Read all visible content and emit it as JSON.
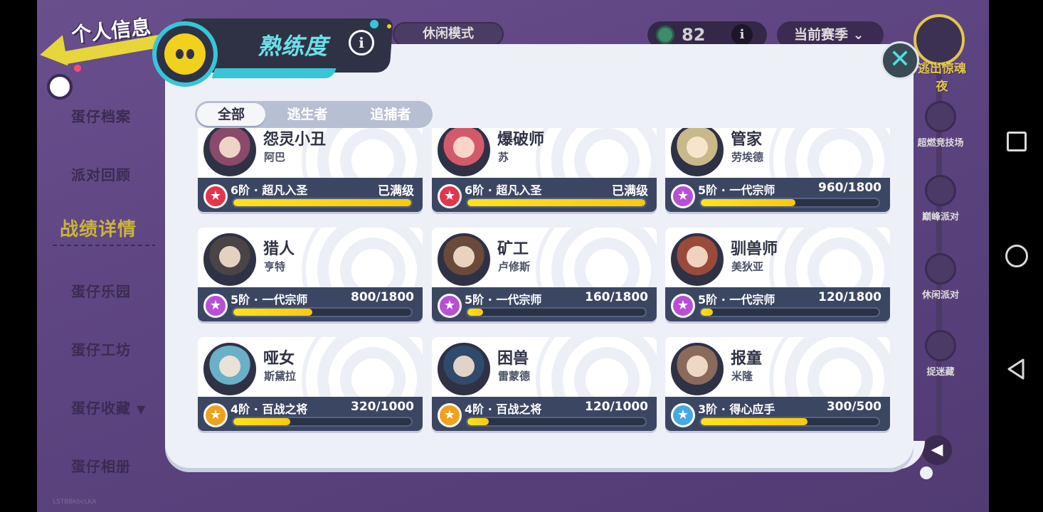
{
  "page_title": "个人信息",
  "side_menu": {
    "items": [
      "蛋仔档案",
      "派对回顾",
      "战绩详情",
      "蛋仔乐园",
      "蛋仔工坊",
      "蛋仔收藏",
      "蛋仔相册"
    ],
    "active_index": 2,
    "collapse_icon": "chevron-down-icon"
  },
  "top_bar": {
    "mode_label": "休闲模式",
    "coin_value": "82",
    "info_glyph": "i",
    "season_label": "当前赛季"
  },
  "right_rail": {
    "top_label": "逃出惊魂夜",
    "items": [
      "超燃竞技场",
      "巅峰派对",
      "休闲派对",
      "捉迷藏"
    ]
  },
  "watermark": "LSTBBkbcLKA",
  "panel": {
    "title": "熟练度",
    "info_glyph": "i",
    "close_glyph": "✕",
    "tabs": [
      "全部",
      "逃生者",
      "追捕者"
    ],
    "active_tab": 0
  },
  "cards": [
    {
      "name": "怨灵小丑",
      "sub": "阿巴",
      "rank": "6阶 · 超凡入圣",
      "value": "已满级",
      "progress": 1.0,
      "badge_color": "#e2374a",
      "avatar_color": "#8a4a6a"
    },
    {
      "name": "爆破师",
      "sub": "苏",
      "rank": "6阶 · 超凡入圣",
      "value": "已满级",
      "progress": 1.0,
      "badge_color": "#e2374a",
      "avatar_color": "#d35a6a"
    },
    {
      "name": "管家",
      "sub": "劳埃德",
      "rank": "5阶 · 一代宗师",
      "value": "960/1800",
      "progress": 0.533,
      "badge_color": "#b94fd6",
      "avatar_color": "#c9b98a"
    },
    {
      "name": "猎人",
      "sub": "亨特",
      "rank": "5阶 · 一代宗师",
      "value": "800/1800",
      "progress": 0.444,
      "badge_color": "#b94fd6",
      "avatar_color": "#4a4446"
    },
    {
      "name": "矿工",
      "sub": "卢修斯",
      "rank": "5阶 · 一代宗师",
      "value": "160/1800",
      "progress": 0.089,
      "badge_color": "#b94fd6",
      "avatar_color": "#6a4a3a"
    },
    {
      "name": "驯兽师",
      "sub": "美狄亚",
      "rank": "5阶 · 一代宗师",
      "value": "120/1800",
      "progress": 0.067,
      "badge_color": "#b94fd6",
      "avatar_color": "#9a4a3a"
    },
    {
      "name": "哑女",
      "sub": "斯黛拉",
      "rank": "4阶 · 百战之将",
      "value": "320/1000",
      "progress": 0.32,
      "badge_color": "#f0a21e",
      "avatar_color": "#6ab0c8"
    },
    {
      "name": "困兽",
      "sub": "雷蒙德",
      "rank": "4阶 · 百战之将",
      "value": "120/1000",
      "progress": 0.12,
      "badge_color": "#f0a21e",
      "avatar_color": "#2f4a6a"
    },
    {
      "name": "报童",
      "sub": "米隆",
      "rank": "3阶 · 得心应手",
      "value": "300/500",
      "progress": 0.6,
      "badge_color": "#4aa8e0",
      "avatar_color": "#8a6a5a"
    }
  ]
}
